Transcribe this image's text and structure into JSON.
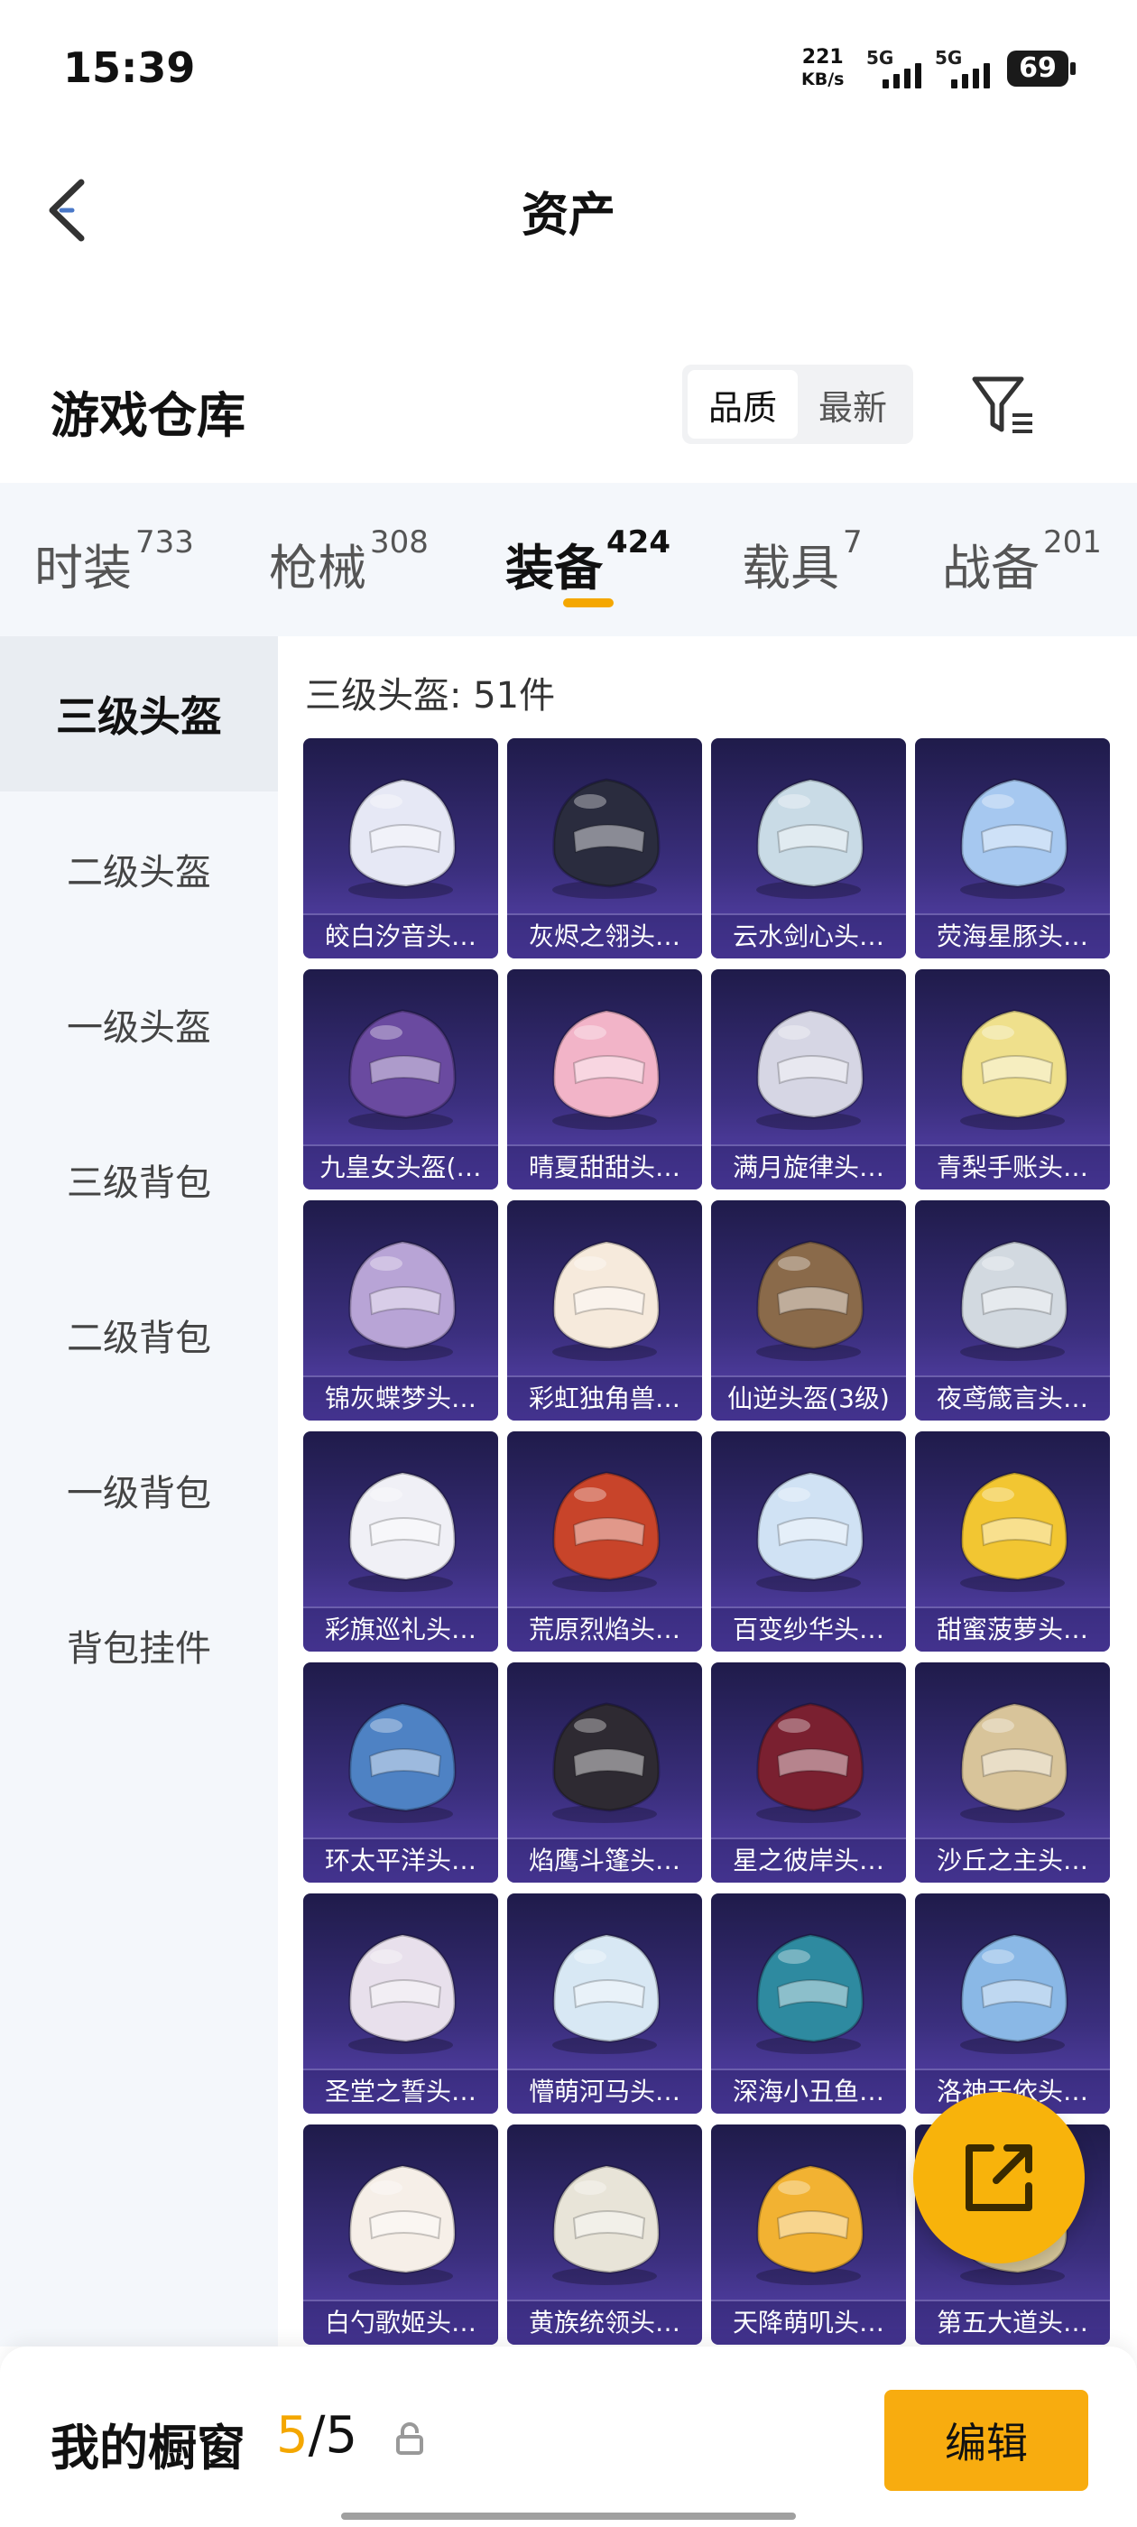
{
  "status_bar": {
    "time": "15:39",
    "net_speed_value": "221",
    "net_speed_unit": "KB/s",
    "signal_1": "5G",
    "signal_2": "5G",
    "battery": "69"
  },
  "header": {
    "title": "资产"
  },
  "warehouse": {
    "title": "游戏仓库",
    "sort_options": [
      "品质",
      "最新"
    ],
    "selected_sort": "品质"
  },
  "tabs": [
    {
      "label": "时装",
      "count": "733"
    },
    {
      "label": "枪械",
      "count": "308"
    },
    {
      "label": "装备",
      "count": "424"
    },
    {
      "label": "载具",
      "count": "7"
    },
    {
      "label": "战备",
      "count": "201"
    }
  ],
  "active_tab": "装备",
  "sidebar": {
    "items": [
      "三级头盔",
      "二级头盔",
      "一级头盔",
      "三级背包",
      "二级背包",
      "一级背包",
      "背包挂件"
    ],
    "active": "三级头盔"
  },
  "content": {
    "title": "三级头盔: 51件"
  },
  "items": [
    {
      "name": "皎白汐音头…",
      "color": "#e6e8f5"
    },
    {
      "name": "灰烬之翎头…",
      "color": "#2a2c3e"
    },
    {
      "name": "云水剑心头…",
      "color": "#c9dbe6"
    },
    {
      "name": "荧海星豚头…",
      "color": "#a6c8f0"
    },
    {
      "name": "九皇女头盔(…",
      "color": "#6a4aa0"
    },
    {
      "name": "晴夏甜甜头…",
      "color": "#f2b4c8"
    },
    {
      "name": "满月旋律头…",
      "color": "#d6d6e4"
    },
    {
      "name": "青梨手账头…",
      "color": "#efe08c"
    },
    {
      "name": "锦灰蝶梦头…",
      "color": "#b8a4d6"
    },
    {
      "name": "彩虹独角兽…",
      "color": "#f6eadc"
    },
    {
      "name": "仙逆头盔(3级)",
      "color": "#8a6a4a"
    },
    {
      "name": "夜鸢箴言头…",
      "color": "#d2d9e0"
    },
    {
      "name": "彩旗巡礼头…",
      "color": "#f0f0f6"
    },
    {
      "name": "荒原烈焰头…",
      "color": "#c8442a"
    },
    {
      "name": "百变纱华头…",
      "color": "#d0e2f4"
    },
    {
      "name": "甜蜜菠萝头…",
      "color": "#f2c632"
    },
    {
      "name": "环太平洋头…",
      "color": "#4e82c4"
    },
    {
      "name": "焰鹰斗篷头…",
      "color": "#2e2a32"
    },
    {
      "name": "星之彼岸头…",
      "color": "#7a2030"
    },
    {
      "name": "沙丘之主头…",
      "color": "#d8c49a"
    },
    {
      "name": "圣堂之誓头…",
      "color": "#e8e0ec"
    },
    {
      "name": "懵萌河马头…",
      "color": "#d8e8f4"
    },
    {
      "name": "深海小丑鱼…",
      "color": "#2e8aa0"
    },
    {
      "name": "洛神天依头…",
      "color": "#8ab8e6"
    },
    {
      "name": "白勺歌姬头…",
      "color": "#f6efe8"
    },
    {
      "name": "黄族统领头…",
      "color": "#e8e4d8"
    },
    {
      "name": "天降萌叽头…",
      "color": "#f2b232"
    },
    {
      "name": "第五大道头…",
      "color": "#d8c89a"
    }
  ],
  "bottom_bar": {
    "label": "我的橱窗",
    "count_current": "5",
    "count_sep": "/",
    "count_total": "5",
    "edit_label": "编辑"
  },
  "colors": {
    "accent": "#f4a700",
    "fab": "#f8b30b",
    "card_top": "#1f1b4a",
    "card_bottom": "#5a44b2",
    "panel_bg": "#f4f7fb"
  }
}
